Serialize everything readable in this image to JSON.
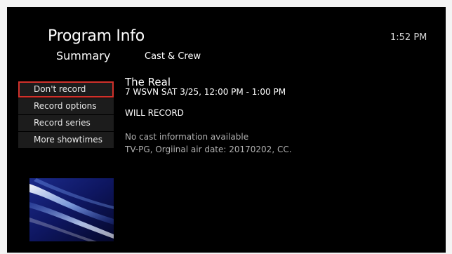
{
  "header": {
    "title": "Program Info",
    "clock": "1:52 PM"
  },
  "tabs": [
    {
      "label": "Summary",
      "selected": true
    },
    {
      "label": "Cast & Crew",
      "selected": false
    }
  ],
  "menu": {
    "items": [
      {
        "label": "Don't record",
        "selected": true
      },
      {
        "label": "Record options",
        "selected": false
      },
      {
        "label": "Record series",
        "selected": false
      },
      {
        "label": "More showtimes",
        "selected": false
      }
    ]
  },
  "program": {
    "name": "The Real",
    "channel_time": "7 WSVN   SAT 3/25, 12:00 PM - 1:00 PM",
    "record_status": "WILL RECORD",
    "cast_info": "No cast information available",
    "rating_info": "TV-PG, Orgiinal air date: 20170202, CC."
  },
  "thumbnail": {
    "icon": "program-thumbnail-image"
  },
  "colors": {
    "background": "#000000",
    "selection_border": "#d0312b",
    "menu_item_bg": "#1c1c1c",
    "secondary_text": "#b0b0b0"
  }
}
